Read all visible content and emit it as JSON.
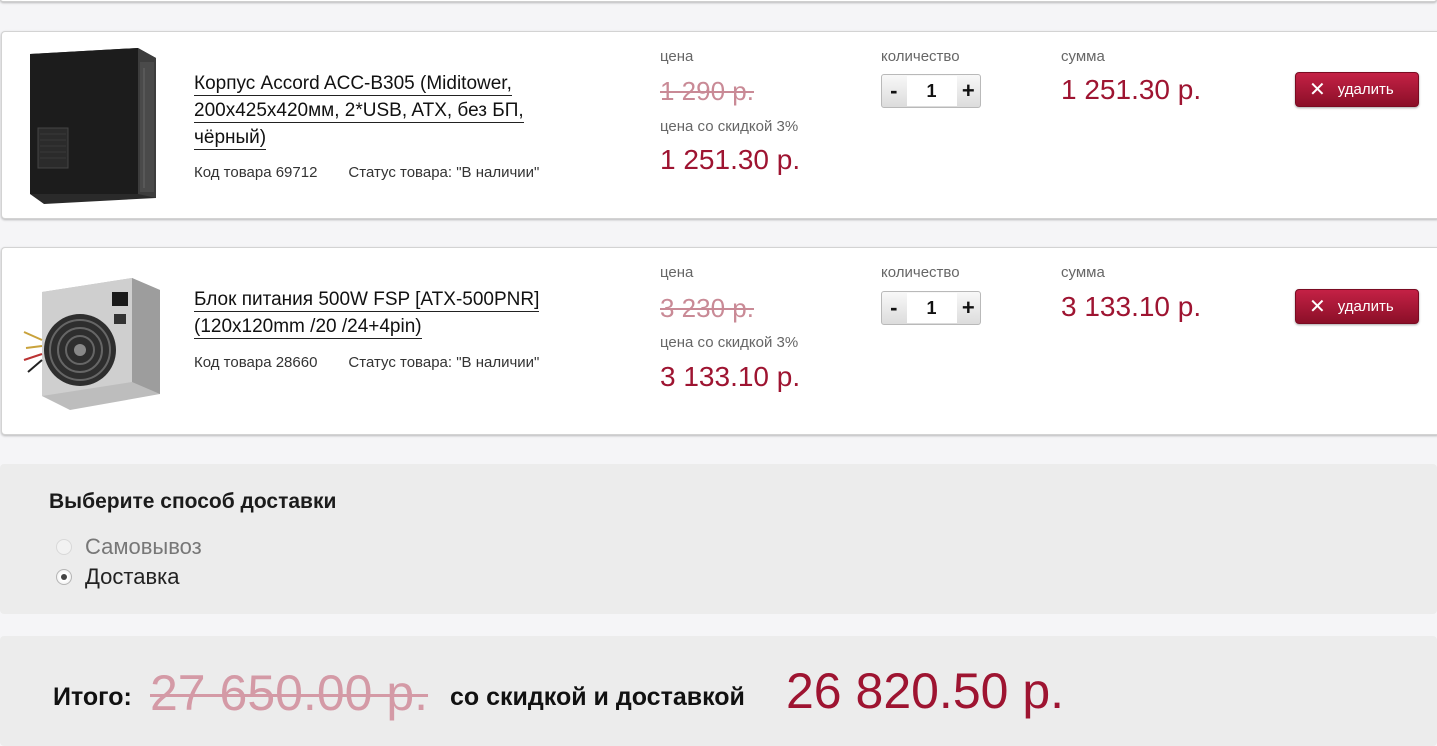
{
  "labels": {
    "price": "цена",
    "quantity": "количество",
    "sum": "сумма",
    "discount_price": "цена со скидкой 3%",
    "delete": "удалить",
    "minus": "-",
    "plus": "+"
  },
  "items": [
    {
      "name": "Корпус Accord ACC-B305 (Miditower, 200x425x420мм, 2*USB, ATX, без БП, чёрный)",
      "name_lines": [
        "Корпус Accord ACC-B305 (Miditower,",
        "200x425x420мм, 2*USB, ATX, без БП,",
        "чёрный)"
      ],
      "code": "Код товара 69712",
      "status": "Статус товара: \"В наличии\"",
      "old_price": "1 290 р.",
      "discount_price": "1 251.30 р.",
      "quantity": "1",
      "sum": "1 251.30 р.",
      "image_icon": "pc-case-image"
    },
    {
      "name": "Блок питания 500W FSP [ATX-500PNR] (120x120mm /20 /24+4pin)",
      "name_lines": [
        "Блок питания 500W FSP [ATX-500PNR]",
        "(120x120mm /20 /24+4pin)"
      ],
      "code": "Код товара 28660",
      "status": "Статус товара: \"В наличии\"",
      "old_price": "3 230 р.",
      "discount_price": "3 133.10 р.",
      "quantity": "1",
      "sum": "3 133.10 р.",
      "image_icon": "power-supply-image"
    }
  ],
  "delivery": {
    "title": "Выберите способ доставки",
    "options": [
      {
        "label": "Самовывоз",
        "checked": false,
        "disabled": true
      },
      {
        "label": "Доставка",
        "checked": true,
        "disabled": false
      }
    ]
  },
  "total": {
    "label": "Итого:",
    "old": "27 650.00 р.",
    "middle": "со скидкой и доставкой",
    "new": "26 820.50 р."
  },
  "colors": {
    "accent": "#9e1431",
    "strike": "#c98a96",
    "delete_button": "#b01a3a"
  }
}
